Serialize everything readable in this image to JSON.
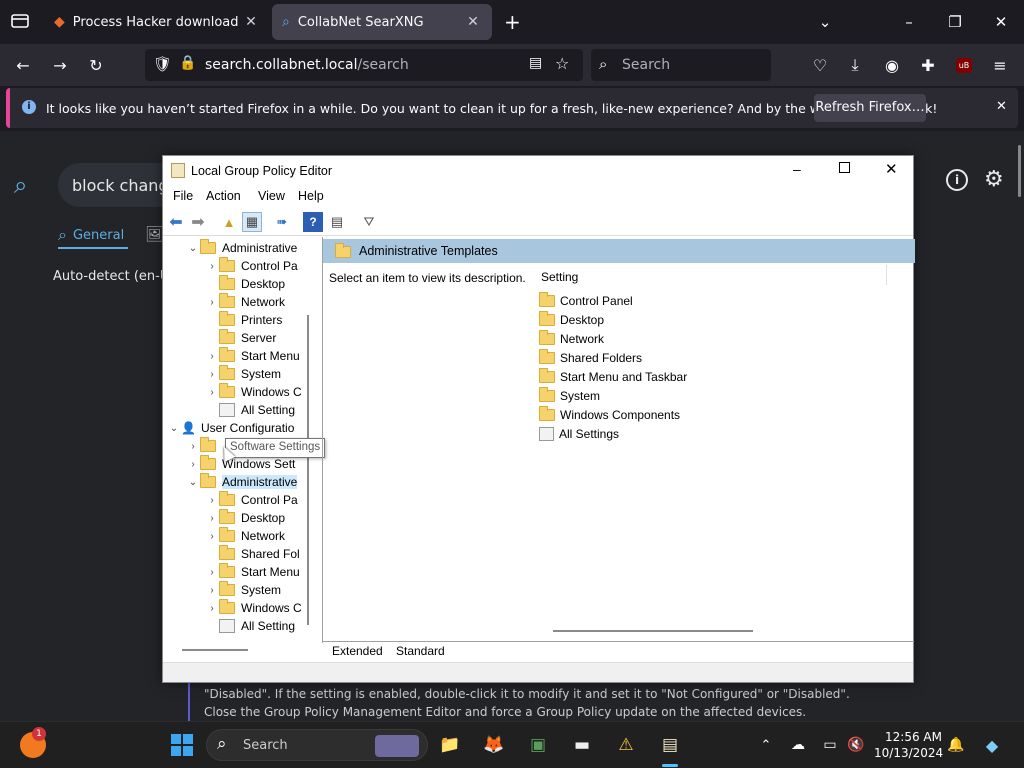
{
  "browser": {
    "tabs": [
      {
        "title": "Process Hacker download | Sou",
        "active": false
      },
      {
        "title": "CollabNet SearXNG",
        "active": true
      }
    ],
    "url_host": "search.collabnet.local",
    "url_path": "/search",
    "search_placeholder": "Search",
    "extension_badge": "uB"
  },
  "notification": {
    "message": "It looks like you haven’t started Firefox in a while. Do you want to clean it up for a fresh, like-new experience? And by the way, welcome back!",
    "button": "Refresh Firefox…"
  },
  "searxng": {
    "query": "block changi",
    "tab_general": "General",
    "language": "Auto-detect (en-US",
    "body_line1": "\"Disabled\". If the setting is enabled, double-click it to modify it and set it to \"Not Configured\" or \"Disabled\".",
    "body_line2": "Close the Group Policy Management Editor and force a Group Policy update on the affected devices."
  },
  "gpe": {
    "title": "Local Group Policy Editor",
    "menu": [
      "File",
      "Action",
      "View",
      "Help"
    ],
    "tree": {
      "computer_admin": "Administrative",
      "computer_children": [
        "Control Pa",
        "Desktop",
        "Network",
        "Printers",
        "Server",
        "Start Menu",
        "System",
        "Windows C",
        "All Setting"
      ],
      "user_config": "User Configuratio",
      "software_settings": "Software Settings",
      "windows_settings": "Windows Sett",
      "user_admin": "Administrative",
      "user_children": [
        "Control Pa",
        "Desktop",
        "Network",
        "Shared Fol",
        "Start Menu",
        "System",
        "Windows C",
        "All Setting"
      ]
    },
    "header": "Administrative Templates",
    "description": "Select an item to view its description.",
    "column_setting": "Setting",
    "settings": [
      "Control Panel",
      "Desktop",
      "Network",
      "Shared Folders",
      "Start Menu and Taskbar",
      "System",
      "Windows Components",
      "All Settings"
    ],
    "tab_extended": "Extended",
    "tab_standard": "Standard"
  },
  "taskbar": {
    "search_label": "Search",
    "time": "12:56 AM",
    "date": "10/13/2024",
    "notification_count": "1"
  },
  "colors": {
    "accent": "#0060df",
    "notif_border": "#e8449a",
    "searxng_blue": "#5dade2",
    "header_blue": "#a8c7df"
  }
}
